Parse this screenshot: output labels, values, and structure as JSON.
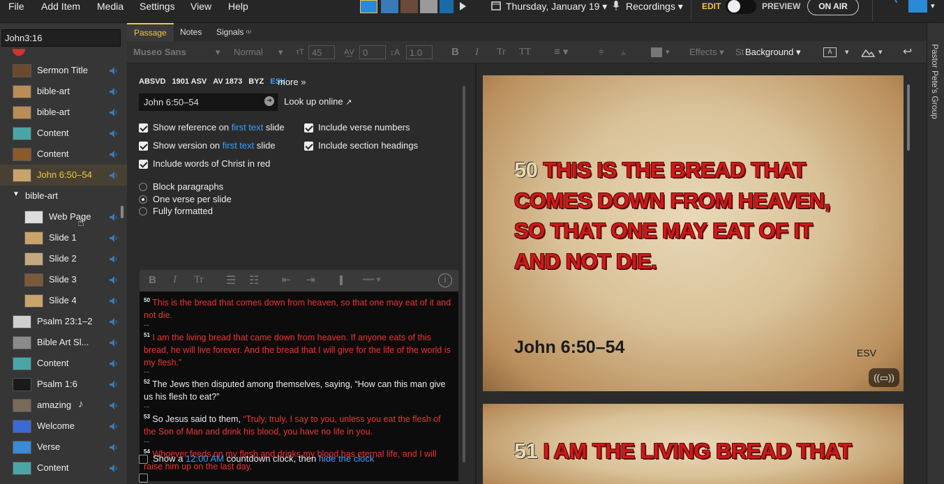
{
  "menu": {
    "file": "File",
    "add_item": "Add Item",
    "media": "Media",
    "settings": "Settings",
    "view": "View",
    "help": "Help"
  },
  "topbar": {
    "date": "Thursday, January 19",
    "recordings": "Recordings",
    "edit": "EDIT",
    "preview": "PREVIEW",
    "on_air": "ON AIR"
  },
  "sidebar": {
    "search_value": "John3:16",
    "items": [
      {
        "label": "Sermon Title",
        "thumb": "#6a4a2a"
      },
      {
        "label": "bible-art",
        "thumb": "#b98d55"
      },
      {
        "label": "bible-art",
        "thumb": "#b98d55"
      },
      {
        "label": "Content",
        "thumb": "#4aa6a6"
      },
      {
        "label": "Content",
        "thumb": "#8a5a2a"
      },
      {
        "label": "John 6:50–54",
        "thumb": "#c9a46a"
      },
      {
        "label": "bible-art"
      },
      {
        "label": "Web Page",
        "thumb": "#dddddd"
      },
      {
        "label": "Slide 1",
        "thumb": "#c9a46a"
      },
      {
        "label": "Slide 2",
        "thumb": "#c7a87e"
      },
      {
        "label": "Slide 3",
        "thumb": "#7a5a3a"
      },
      {
        "label": "Slide 4",
        "thumb": "#c9a46a"
      },
      {
        "label": "Psalm 23:1–2",
        "thumb": "#cfcfcf"
      },
      {
        "label": "Bible Art Sl...",
        "thumb": "#8a8a8a"
      },
      {
        "label": "Content",
        "thumb": "#4aa6a6"
      },
      {
        "label": "Psalm 1:6",
        "thumb": "#1a1a1a"
      },
      {
        "label": "amazing",
        "note": "♪",
        "thumb": "#7a6a5a"
      },
      {
        "label": "Welcome",
        "thumb": "#3a6ad6"
      },
      {
        "label": "Verse",
        "thumb": "#3a8ad6"
      },
      {
        "label": "Content",
        "thumb": "#4aa6a6"
      }
    ]
  },
  "editor": {
    "tabs": {
      "passage": "Passage",
      "notes": "Notes",
      "signals": "Signals"
    },
    "font": "Museo Sans",
    "style": "Normal",
    "size": "45",
    "tracking": "0",
    "line_height": "1.0",
    "effects": "Effects",
    "st": "St",
    "background": "Background",
    "versions": [
      "ABSVD",
      "1901 ASV",
      "AV 1873",
      "BYZ",
      "ESV"
    ],
    "active_version": "ESV",
    "more": "more »",
    "reference": "John 6:50–54",
    "lookup": "Look up online",
    "options": {
      "show_reference": "Show reference on",
      "show_version": "Show version on",
      "first_text": "first text",
      "slide": "slide",
      "words_red": "Include words of Christ in red",
      "verse_numbers": "Include verse numbers",
      "section_headings": "Include section headings",
      "block": "Block paragraphs",
      "one_verse": "One verse per slide",
      "fully": "Fully formatted"
    },
    "verses": [
      {
        "num": "50",
        "parts": [
          {
            "t": "This is the bread that comes down from heaven, so that one may eat of it and not die.",
            "red": true
          }
        ]
      },
      {
        "num": "51",
        "parts": [
          {
            "t": "I am the living bread that came down from heaven. If anyone eats of this bread, he will live forever. And the bread that I will give for the life of the world is my flesh.”",
            "red": true
          }
        ]
      },
      {
        "num": "52",
        "parts": [
          {
            "t": "The Jews then disputed among themselves, saying, “How can this man give us his flesh to eat?”",
            "red": false
          }
        ]
      },
      {
        "num": "53",
        "parts": [
          {
            "t": "So Jesus said to them, ",
            "red": false
          },
          {
            "t": "“Truly, truly, I say to you, unless you eat the flesh of the Son of Man and drink his blood, you have no life in you.",
            "red": true
          }
        ]
      },
      {
        "num": "54",
        "parts": [
          {
            "t": "Whoever feeds on my flesh and drinks my blood has eternal life, and I will raise him up on the last day.",
            "red": true
          }
        ]
      }
    ],
    "separator": "--",
    "clock": {
      "pre": "Show a",
      "time": "12:00 AM",
      "mid": "countdown clock, then",
      "post": "hide the clock"
    }
  },
  "preview": {
    "slide1": {
      "num": "50",
      "line1": "THIS IS THE BREAD THAT",
      "line2": "COMES DOWN FROM HEAVEN,",
      "line3": "SO THAT ONE MAY EAT OF IT",
      "line4": "AND NOT DIE.",
      "reference": "John 6:50–54",
      "version": "ESV"
    },
    "slide2": {
      "num": "51",
      "line1": "I AM THE LIVING BREAD THAT"
    }
  },
  "right_panel": {
    "label": "Pastor Pete's Group"
  }
}
